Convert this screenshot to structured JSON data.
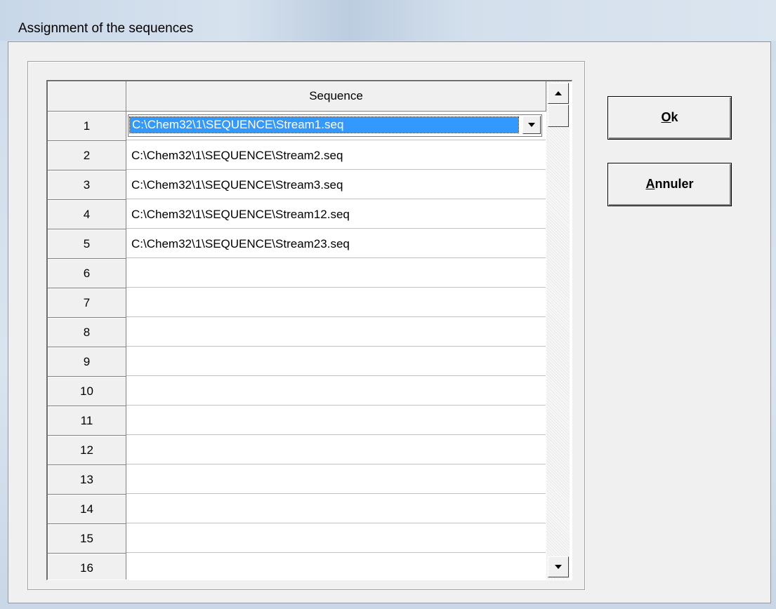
{
  "window": {
    "title": "Assignment of the sequences"
  },
  "grid": {
    "column_header": "Sequence",
    "rows": [
      {
        "num": "1",
        "value": "C:\\Chem32\\1\\SEQUENCE\\Stream1.seq"
      },
      {
        "num": "2",
        "value": "C:\\Chem32\\1\\SEQUENCE\\Stream2.seq"
      },
      {
        "num": "3",
        "value": "C:\\Chem32\\1\\SEQUENCE\\Stream3.seq"
      },
      {
        "num": "4",
        "value": "C:\\Chem32\\1\\SEQUENCE\\Stream12.seq"
      },
      {
        "num": "5",
        "value": "C:\\Chem32\\1\\SEQUENCE\\Stream23.seq"
      },
      {
        "num": "6",
        "value": ""
      },
      {
        "num": "7",
        "value": ""
      },
      {
        "num": "8",
        "value": ""
      },
      {
        "num": "9",
        "value": ""
      },
      {
        "num": "10",
        "value": ""
      },
      {
        "num": "11",
        "value": ""
      },
      {
        "num": "12",
        "value": ""
      },
      {
        "num": "13",
        "value": ""
      },
      {
        "num": "14",
        "value": ""
      },
      {
        "num": "15",
        "value": ""
      },
      {
        "num": "16",
        "value": ""
      }
    ]
  },
  "buttons": {
    "ok": {
      "accel": "O",
      "rest": "k"
    },
    "cancel": {
      "accel": "A",
      "rest": "nnuler"
    }
  },
  "icons": {
    "dropdown": "chevron-down-icon",
    "scroll_up": "scroll-up-arrow-icon",
    "scroll_down": "scroll-down-arrow-icon"
  },
  "colors": {
    "selection": "#3399ff",
    "face": "#f0f0f0"
  }
}
